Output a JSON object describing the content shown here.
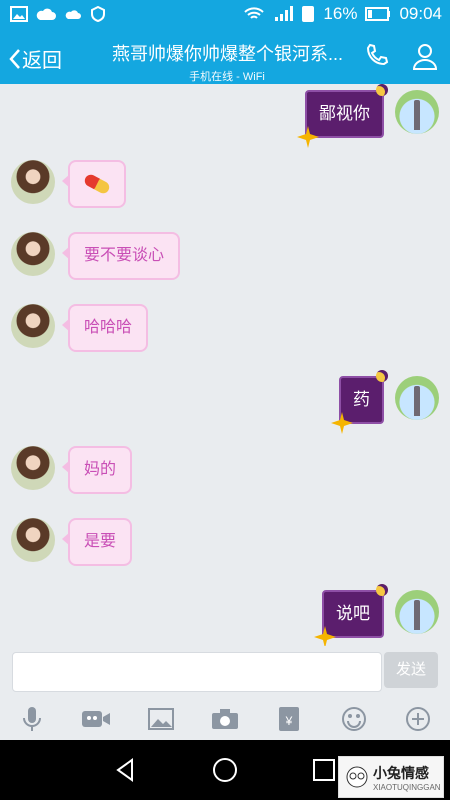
{
  "status_bar": {
    "battery": "16%",
    "time": "09:04"
  },
  "header": {
    "back_label": "返回",
    "title": "燕哥帅爆你帅爆整个银河系...",
    "subtitle": "手机在线 - WiFi"
  },
  "messages": [
    {
      "side": "right",
      "text": "鄙视你"
    },
    {
      "side": "left",
      "text": "💊"
    },
    {
      "side": "left",
      "text": "要不要谈心"
    },
    {
      "side": "left",
      "text": "哈哈哈"
    },
    {
      "side": "right",
      "text": "药"
    },
    {
      "side": "left",
      "text": "妈的"
    },
    {
      "side": "left",
      "text": "是要"
    },
    {
      "side": "right",
      "text": "说吧"
    }
  ],
  "input": {
    "value": "",
    "send_label": "发送"
  },
  "toolbar_icons": [
    "mic-icon",
    "video-icon",
    "image-icon",
    "camera-icon",
    "red-packet-icon",
    "emoji-icon",
    "plus-icon"
  ],
  "watermark": {
    "text": "小兔情感",
    "sub": "XIAOTUQINGGAN"
  },
  "colors": {
    "header": "#14a7e0",
    "bubble_left_bg": "#fbe3f3",
    "bubble_left_text": "#c94fb6",
    "bubble_right_bg": "#5b1e6d"
  }
}
